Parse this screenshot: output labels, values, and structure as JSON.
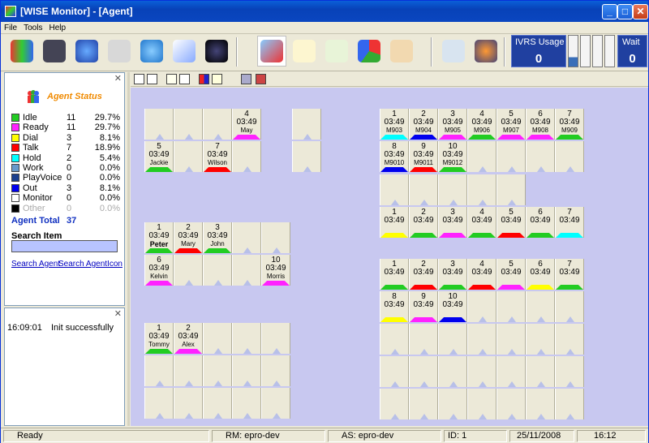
{
  "window": {
    "title": "[WISE Monitor] - [Agent]"
  },
  "menu": [
    "File",
    "Tools",
    "Help"
  ],
  "toolbar_icons": [
    "agents-icon",
    "server-icon",
    "map-pin-icon",
    "printer-icon",
    "phone-icon",
    "pen-icon",
    "globe-icon",
    "agent-monitor-icon",
    "envelope-icon",
    "email-forward-icon",
    "pie-chart-icon",
    "handset-icon",
    "device-icon",
    "settings-gear-icon"
  ],
  "ivrs": {
    "label": "IVRS Usage",
    "value": "0"
  },
  "wait": {
    "label": "Wait",
    "value": "0"
  },
  "agent_status": {
    "title": "Agent Status",
    "rows": [
      {
        "name": "Idle",
        "count": "11",
        "pct": "29.7%",
        "color": "#22cc22"
      },
      {
        "name": "Ready",
        "count": "11",
        "pct": "29.7%",
        "color": "#ff22ff"
      },
      {
        "name": "Dial",
        "count": "3",
        "pct": "8.1%",
        "color": "#ffff00"
      },
      {
        "name": "Talk",
        "count": "7",
        "pct": "18.9%",
        "color": "#ff0000"
      },
      {
        "name": "Hold",
        "count": "2",
        "pct": "5.4%",
        "color": "#00ffff"
      },
      {
        "name": "Work",
        "count": "0",
        "pct": "0.0%",
        "color": "#6699cc"
      },
      {
        "name": "PlayVoice",
        "count": "0",
        "pct": "0.0%",
        "color": "#1a3f8f"
      },
      {
        "name": "Out",
        "count": "3",
        "pct": "8.1%",
        "color": "#0000ee"
      },
      {
        "name": "Monitor",
        "count": "0",
        "pct": "0.0%",
        "color": "#ffffff"
      },
      {
        "name": "Other",
        "count": "0",
        "pct": "0.0%",
        "color": "#000000",
        "dim": true
      }
    ],
    "total_label": "Agent Total",
    "total": "37",
    "search_label": "Search Item",
    "search_agent": "Search Agent",
    "search_agent_icon": "Search AgentIcon"
  },
  "log": [
    {
      "time": "16:09:01",
      "msg": "Init successfully"
    }
  ],
  "groups": [
    {
      "cols": 4,
      "rows": 2,
      "agents": {
        "3": {
          "n": "4",
          "t": "03:49",
          "name": "May",
          "c": "#ff22ff"
        },
        "4": {
          "n": "5",
          "t": "03:49",
          "name": "Jackie",
          "c": "#22cc22"
        },
        "6": {
          "n": "7",
          "t": "03:49",
          "name": "Wilson",
          "c": "#ff0000"
        }
      }
    },
    {
      "cols": 1,
      "rows": 2,
      "agents": {}
    },
    {
      "cols": 7,
      "rows": 2,
      "agents": {
        "0": {
          "n": "1",
          "t": "03:49",
          "name": "M903",
          "c": "#00ffff"
        },
        "1": {
          "n": "2",
          "t": "03:49",
          "name": "M904",
          "c": "#0000ee"
        },
        "2": {
          "n": "3",
          "t": "03:49",
          "name": "M905",
          "c": "#ff22ff"
        },
        "3": {
          "n": "4",
          "t": "03:49",
          "name": "M906",
          "c": "#22cc22"
        },
        "4": {
          "n": "5",
          "t": "03:49",
          "name": "M907",
          "c": "#ff22ff"
        },
        "5": {
          "n": "6",
          "t": "03:49",
          "name": "M908",
          "c": "#ff22ff"
        },
        "6": {
          "n": "7",
          "t": "03:49",
          "name": "M909",
          "c": "#22cc22"
        },
        "7": {
          "n": "8",
          "t": "03:49",
          "name": "M9010",
          "c": "#0000ee"
        },
        "8": {
          "n": "9",
          "t": "03:49",
          "name": "M9011",
          "c": "#ff0000"
        },
        "9": {
          "n": "10",
          "t": "03:49",
          "name": "M9012",
          "c": "#22cc22"
        }
      }
    },
    {
      "cols": 5,
      "rows": 1,
      "agents": {}
    },
    {
      "cols": 7,
      "rows": 1,
      "agents": {
        "0": {
          "n": "1",
          "t": "03:49",
          "name": "",
          "c": "#ffff00"
        },
        "1": {
          "n": "2",
          "t": "03:49",
          "name": "",
          "c": "#22cc22"
        },
        "2": {
          "n": "3",
          "t": "03:49",
          "name": "",
          "c": "#ff22ff"
        },
        "3": {
          "n": "4",
          "t": "03:49",
          "name": "",
          "c": "#22cc22"
        },
        "4": {
          "n": "5",
          "t": "03:49",
          "name": "",
          "c": "#ff0000"
        },
        "5": {
          "n": "6",
          "t": "03:49",
          "name": "",
          "c": "#22cc22"
        },
        "6": {
          "n": "7",
          "t": "03:49",
          "name": "",
          "c": "#00ffff"
        }
      }
    },
    {
      "cols": 5,
      "rows": 2,
      "agents": {
        "0": {
          "n": "1",
          "t": "03:49",
          "name": "Peter",
          "c": "#22cc22",
          "b": true
        },
        "1": {
          "n": "2",
          "t": "03:49",
          "name": "Mary",
          "c": "#ff0000"
        },
        "2": {
          "n": "3",
          "t": "03:49",
          "name": "John",
          "c": "#22cc22"
        },
        "5": {
          "n": "6",
          "t": "03:49",
          "name": "Kelvin",
          "c": "#ff22ff"
        },
        "9": {
          "n": "10",
          "t": "03:49",
          "name": "Morris",
          "c": "#ff22ff"
        }
      }
    },
    {
      "cols": 7,
      "rows": 2,
      "agents": {
        "0": {
          "n": "1",
          "t": "03:49",
          "name": "",
          "c": "#22cc22"
        },
        "1": {
          "n": "2",
          "t": "03:49",
          "name": "",
          "c": "#ff0000"
        },
        "2": {
          "n": "3",
          "t": "03:49",
          "name": "",
          "c": "#22cc22"
        },
        "3": {
          "n": "4",
          "t": "03:49",
          "name": "",
          "c": "#ff0000"
        },
        "4": {
          "n": "5",
          "t": "03:49",
          "name": "",
          "c": "#ff22ff"
        },
        "5": {
          "n": "6",
          "t": "03:49",
          "name": "",
          "c": "#ffff00"
        },
        "6": {
          "n": "7",
          "t": "03:49",
          "name": "",
          "c": "#22cc22"
        },
        "7": {
          "n": "8",
          "t": "03:49",
          "name": "",
          "c": "#ffff00"
        },
        "8": {
          "n": "9",
          "t": "03:49",
          "name": "",
          "c": "#ff22ff"
        },
        "9": {
          "n": "10",
          "t": "03:49",
          "name": "",
          "c": "#0000ee"
        }
      }
    },
    {
      "cols": 5,
      "rows": 3,
      "agents": {
        "0": {
          "n": "1",
          "t": "03:49",
          "name": "Tommy",
          "c": "#22cc22"
        },
        "1": {
          "n": "2",
          "t": "03:49",
          "name": "Alex",
          "c": "#ff22ff"
        }
      }
    },
    {
      "cols": 7,
      "rows": 3,
      "agents": {}
    }
  ],
  "status": {
    "ready": "Ready",
    "rm": "RM: epro-dev",
    "as": "AS: epro-dev",
    "id": "ID: 1",
    "date": "25/11/2008",
    "time": "16:12"
  }
}
